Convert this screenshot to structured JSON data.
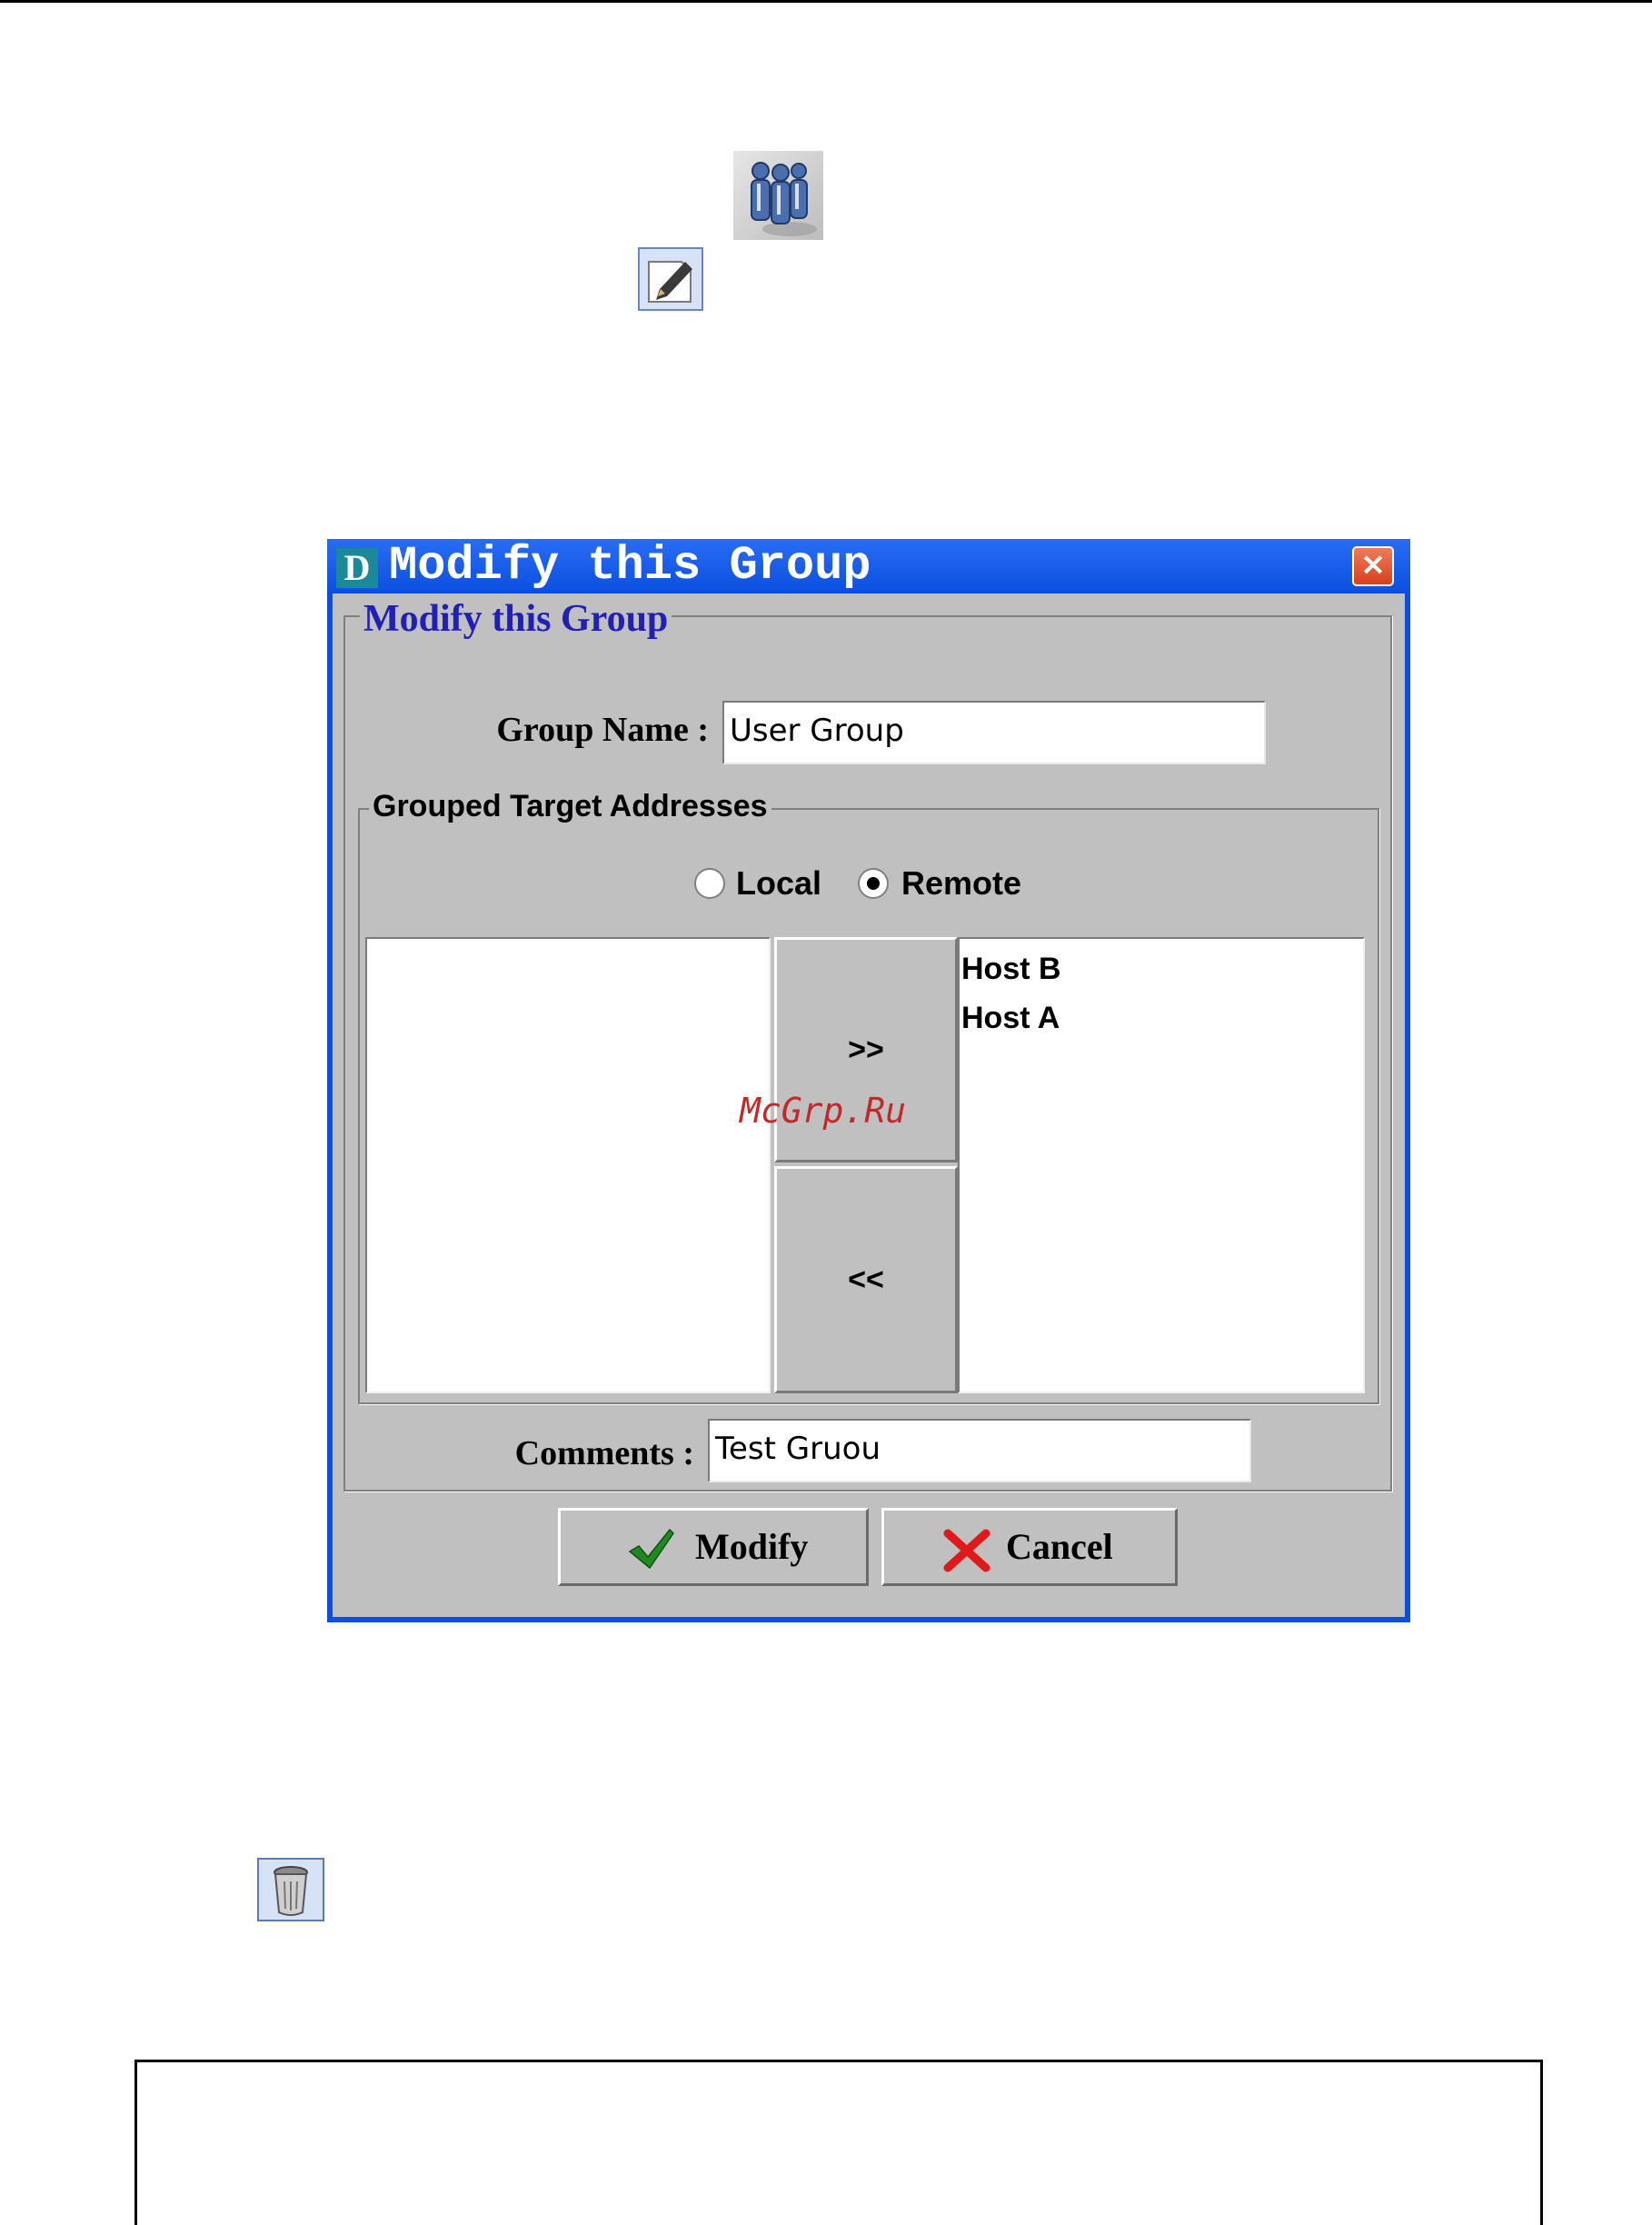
{
  "dialog": {
    "title": "Modify this Group",
    "title_logo": "D",
    "close_glyph": "✕",
    "group_legend": "Modify this Group",
    "group_name_label": "Group Name :",
    "group_name_value": "User Group",
    "targets_legend": "Grouped Target Addresses",
    "radio_local_label": "Local",
    "radio_remote_label": "Remote",
    "selected_radio": "Remote",
    "available_items": [],
    "selected_items": [
      "Host B",
      "Host A"
    ],
    "add_button": ">>",
    "remove_button": "<<",
    "comments_label": "Comments :",
    "comments_value": "Test Gruou",
    "modify_button": "Modify",
    "cancel_button": "Cancel"
  },
  "watermark": "McGrp.Ru",
  "icons": {
    "users": "users-group-icon",
    "edit": "edit-pencil-icon",
    "trash": "trash-bin-icon",
    "check": "checkmark-icon",
    "cross": "red-x-icon"
  },
  "colors": {
    "titlebar": "#0a4fe0",
    "dialog_bg": "#c0c0c0",
    "legend_blue": "#2020b8",
    "watermark": "#c62828"
  }
}
